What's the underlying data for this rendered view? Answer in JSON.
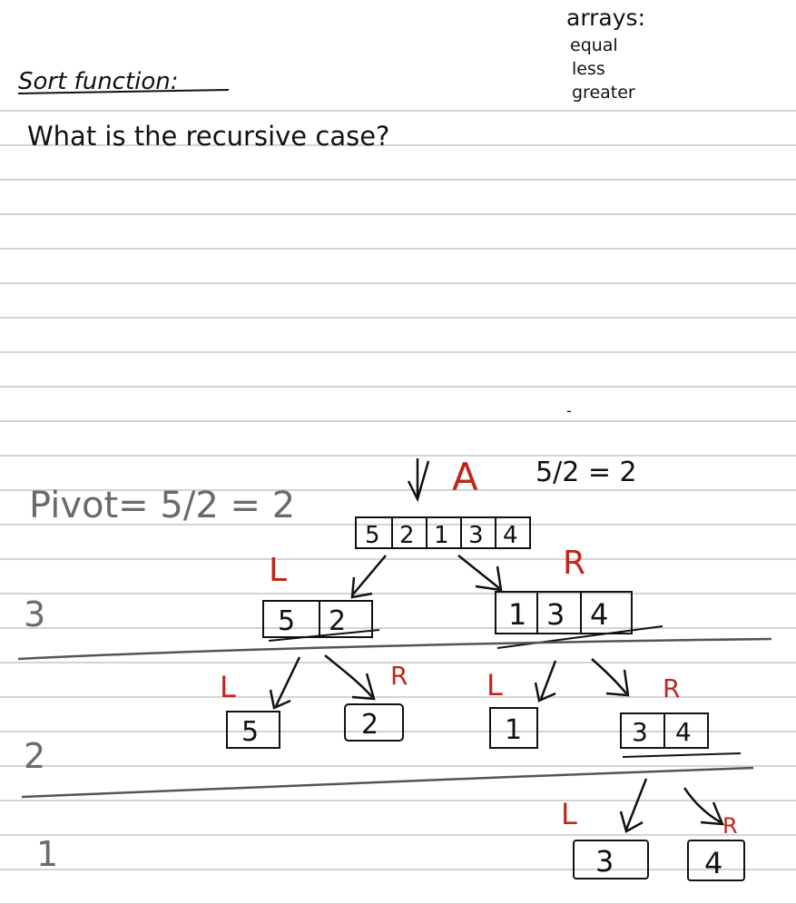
{
  "notes": {
    "title": "Sort function:",
    "question": "What is the recursive case?",
    "arrays_heading": "arrays:",
    "arrays_items": [
      "equal",
      "less",
      "greater"
    ],
    "stray_mark": "-"
  },
  "diagram": {
    "pivot_text": "Pivot= 5/2 = 2",
    "pivot_calc_right": "5/2 = 2",
    "root_label": "A",
    "root_array": [
      "5",
      "2",
      "1",
      "3",
      "4"
    ],
    "left_label": "L",
    "right_label": "R",
    "level3": {
      "label": "3",
      "left_array": [
        "5",
        "2"
      ],
      "right_array": [
        "1",
        "3",
        "4"
      ]
    },
    "level2": {
      "label": "2",
      "nodes": [
        "5",
        "2",
        "1"
      ],
      "right_array": [
        "3",
        "4"
      ]
    },
    "level1": {
      "label": "1",
      "nodes": [
        "3",
        "4"
      ]
    }
  },
  "colors": {
    "ink": "#111111",
    "gray_ink": "#6a6a6a",
    "red_ink": "#c0261b",
    "rule_line": "#d4d4d4",
    "divider": "#555555"
  }
}
